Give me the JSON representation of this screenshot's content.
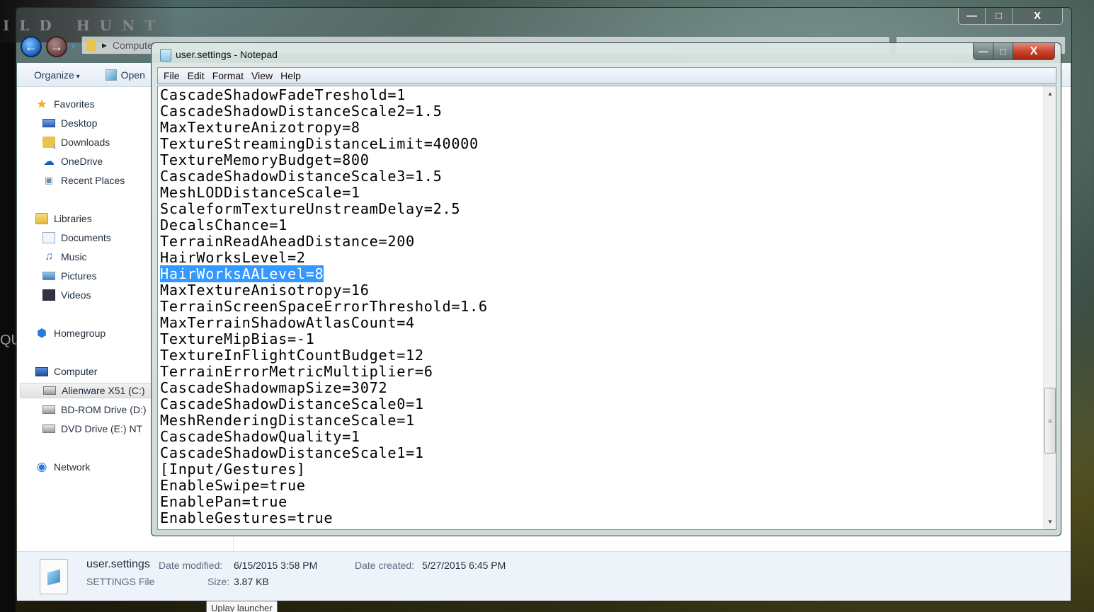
{
  "background": {
    "game_logo_text": "ILD HUNT",
    "side_letter": "QU"
  },
  "explorer": {
    "window_controls": {
      "minimize": "—",
      "maximize": "□",
      "close": "X"
    },
    "address": {
      "text": "Computer",
      "arrow": "▶"
    },
    "search_placeholder": "",
    "toolbar": {
      "organize": "Organize",
      "open": "Open"
    },
    "nav_pane": {
      "favorites": {
        "label": "Favorites",
        "items": [
          "Desktop",
          "Downloads",
          "OneDrive",
          "Recent Places"
        ]
      },
      "libraries": {
        "label": "Libraries",
        "items": [
          "Documents",
          "Music",
          "Pictures",
          "Videos"
        ]
      },
      "homegroup": "Homegroup",
      "computer": {
        "label": "Computer",
        "items": [
          "Alienware X51 (C:)",
          "BD-ROM Drive (D:)",
          "DVD Drive (E:) NT"
        ],
        "selected": "Alienware X51 (C:)"
      },
      "network": "Network"
    },
    "details": {
      "file_name": "user.settings",
      "file_type": "SETTINGS File",
      "date_modified_label": "Date modified:",
      "date_modified": "6/15/2015 3:58 PM",
      "date_created_label": "Date created:",
      "date_created": "5/27/2015 6:45 PM",
      "size_label": "Size:",
      "size": "3.87 KB"
    }
  },
  "notepad": {
    "title": "user.settings - Notepad",
    "window_controls": {
      "minimize": "—",
      "maximize": "□",
      "close": "X"
    },
    "menu": [
      "File",
      "Edit",
      "Format",
      "View",
      "Help"
    ],
    "selected_line_index": 11,
    "lines": [
      "CascadeShadowFadeTreshold=1",
      "CascadeShadowDistanceScale2=1.5",
      "MaxTextureAnizotropy=8",
      "TextureStreamingDistanceLimit=40000",
      "TextureMemoryBudget=800",
      "CascadeShadowDistanceScale3=1.5",
      "MeshLODDistanceScale=1",
      "ScaleformTextureUnstreamDelay=2.5",
      "DecalsChance=1",
      "TerrainReadAheadDistance=200",
      "HairWorksLevel=2",
      "HairWorksAALevel=8",
      "MaxTextureAnisotropy=16",
      "TerrainScreenSpaceErrorThreshold=1.6",
      "MaxTerrainShadowAtlasCount=4",
      "TextureMipBias=-1",
      "TextureInFlightCountBudget=12",
      "TerrainErrorMetricMultiplier=6",
      "CascadeShadowmapSize=3072",
      "CascadeShadowDistanceScale0=1",
      "MeshRenderingDistanceScale=1",
      "CascadeShadowQuality=1",
      "CascadeShadowDistanceScale1=1",
      "[Input/Gestures]",
      "EnableSwipe=true",
      "EnablePan=true",
      "EnableGestures=true"
    ],
    "scrollbar": {
      "up": "▲",
      "down": "▼",
      "grip": "≡",
      "position_fraction": 0.78
    }
  },
  "tooltip": "Uplay launcher",
  "colors": {
    "selection": "#3399ff",
    "close_button": "#c9452c"
  }
}
